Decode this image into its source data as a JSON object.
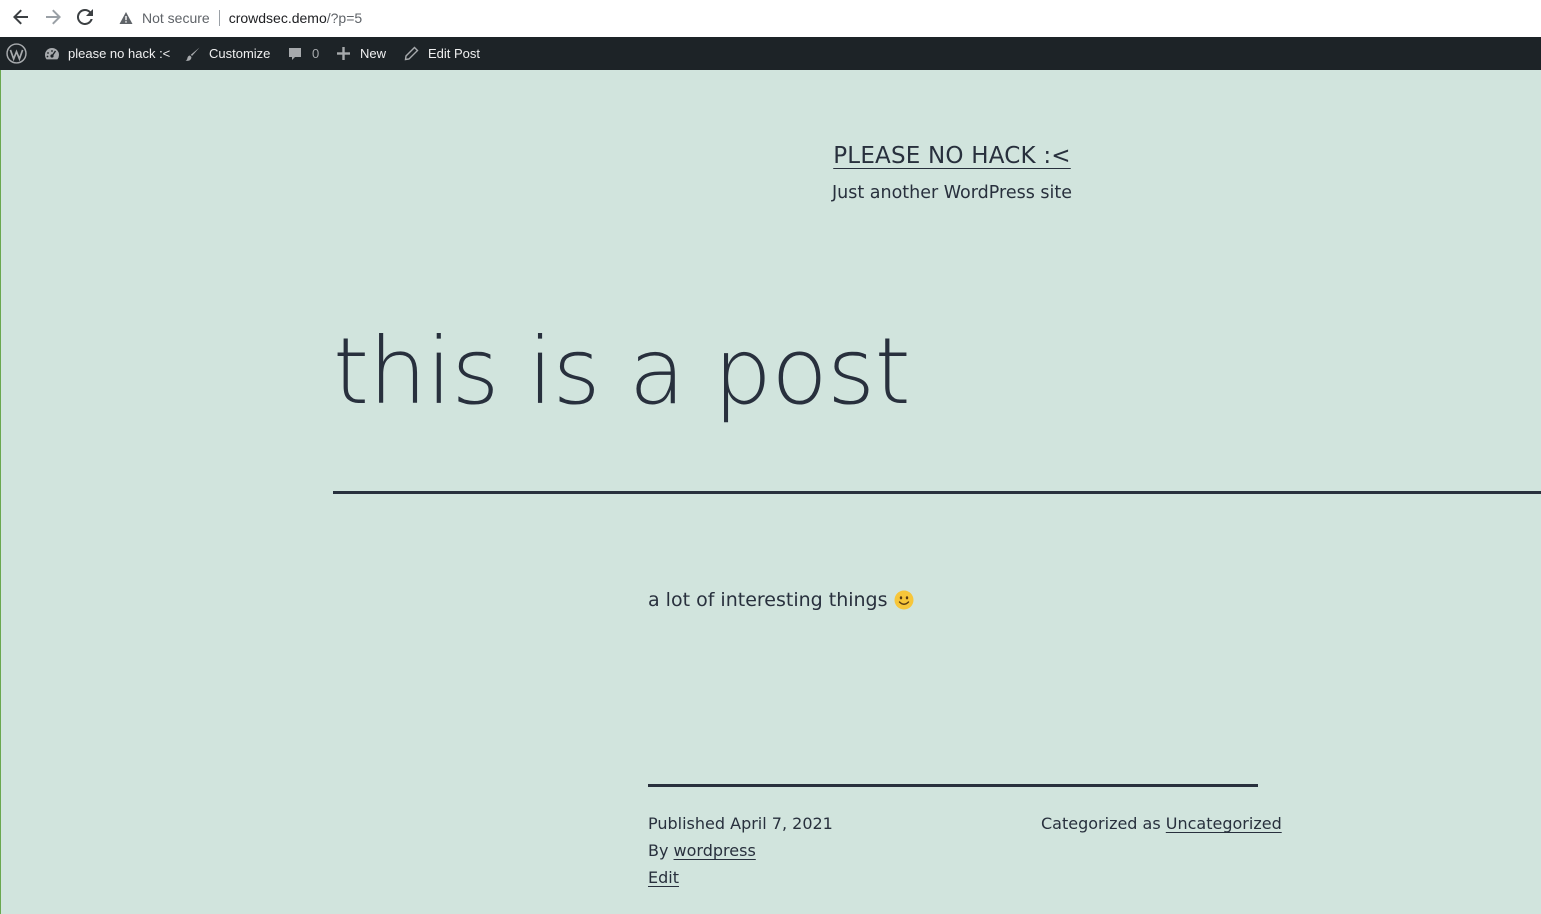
{
  "browser": {
    "security_label": "Not secure",
    "url_host": "crowdsec.demo",
    "url_path": "/?p=5",
    "icons": [
      "back-icon",
      "forward-icon",
      "reload-icon",
      "warning-icon"
    ]
  },
  "adminbar": {
    "site_name": "please no hack :<",
    "customize": "Customize",
    "comments_count": "0",
    "new": "New",
    "edit_post": "Edit Post"
  },
  "site": {
    "title": "PLEASE NO HACK :<",
    "description": "Just another WordPress site"
  },
  "post": {
    "title": "this is a post",
    "content": "a lot of interesting things",
    "emoji": "smiley-emoji"
  },
  "footer": {
    "published_prefix": "Published",
    "published_date": "April 7, 2021",
    "by_prefix": "By",
    "author": "wordpress",
    "edit": "Edit",
    "categorized_prefix": "Categorized as",
    "category": "Uncategorized"
  },
  "colors": {
    "background": "#d1e4dd",
    "text": "#28303d",
    "adminbar": "#1d2327"
  }
}
